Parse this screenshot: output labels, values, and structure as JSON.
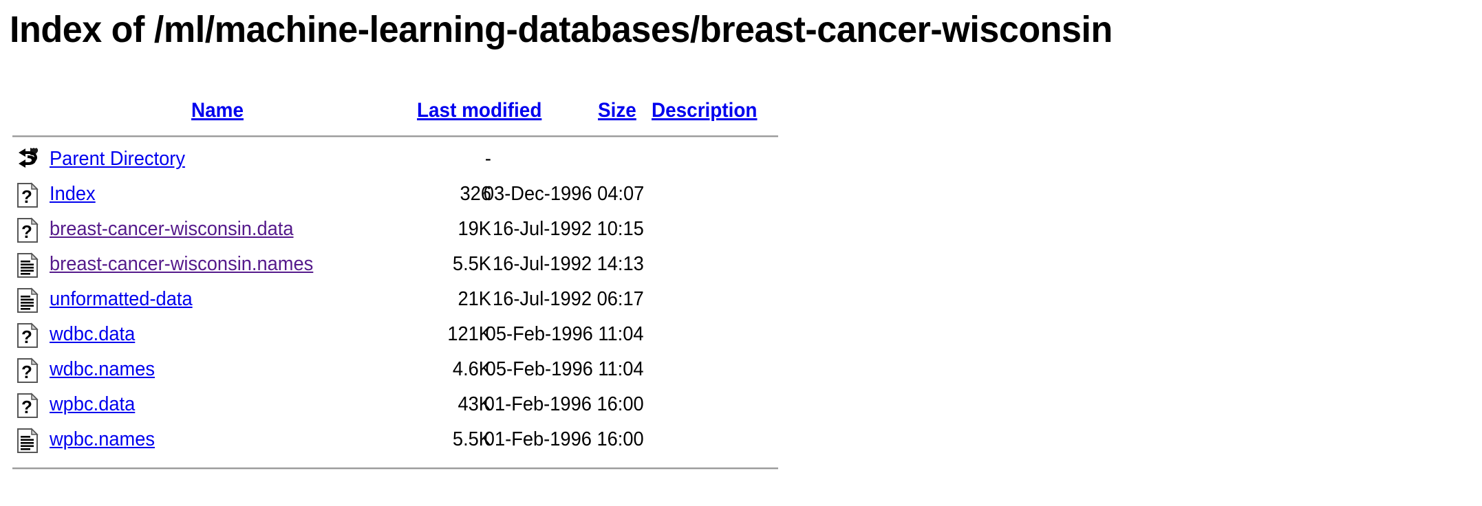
{
  "page": {
    "title": "Index of /ml/machine-learning-databases/breast-cancer-wisconsin"
  },
  "colors": {
    "link": "#0000EE",
    "visited_link": "#551A8B",
    "text": "#000000",
    "rule": "#9A9A9A",
    "background": "#FFFFFF"
  },
  "table": {
    "headers": {
      "name": "Name",
      "last_modified": "Last modified",
      "size": "Size",
      "description": "Description"
    },
    "rows": [
      {
        "icon": "back-arrow-icon",
        "name": "Parent Directory",
        "last_modified": "",
        "size": "-",
        "description": "",
        "visited": false
      },
      {
        "icon": "unknown-file-icon",
        "name": "Index",
        "last_modified": "03-Dec-1996 04:07",
        "size": "326",
        "description": "",
        "visited": false
      },
      {
        "icon": "unknown-file-icon",
        "name": "breast-cancer-wisconsin.data",
        "last_modified": "16-Jul-1992 10:15",
        "size": "19K",
        "description": "",
        "visited": true
      },
      {
        "icon": "text-file-icon",
        "name": "breast-cancer-wisconsin.names",
        "last_modified": "16-Jul-1992 14:13",
        "size": "5.5K",
        "description": "",
        "visited": true
      },
      {
        "icon": "text-file-icon",
        "name": "unformatted-data",
        "last_modified": "16-Jul-1992 06:17",
        "size": "21K",
        "description": "",
        "visited": false
      },
      {
        "icon": "unknown-file-icon",
        "name": "wdbc.data",
        "last_modified": "05-Feb-1996 11:04",
        "size": "121K",
        "description": "",
        "visited": false
      },
      {
        "icon": "unknown-file-icon",
        "name": "wdbc.names",
        "last_modified": "05-Feb-1996 11:04",
        "size": "4.6K",
        "description": "",
        "visited": false
      },
      {
        "icon": "unknown-file-icon",
        "name": "wpbc.data",
        "last_modified": "01-Feb-1996 16:00",
        "size": "43K",
        "description": "",
        "visited": false
      },
      {
        "icon": "text-file-icon",
        "name": "wpbc.names",
        "last_modified": "01-Feb-1996 16:00",
        "size": "5.5K",
        "description": "",
        "visited": false
      }
    ]
  }
}
